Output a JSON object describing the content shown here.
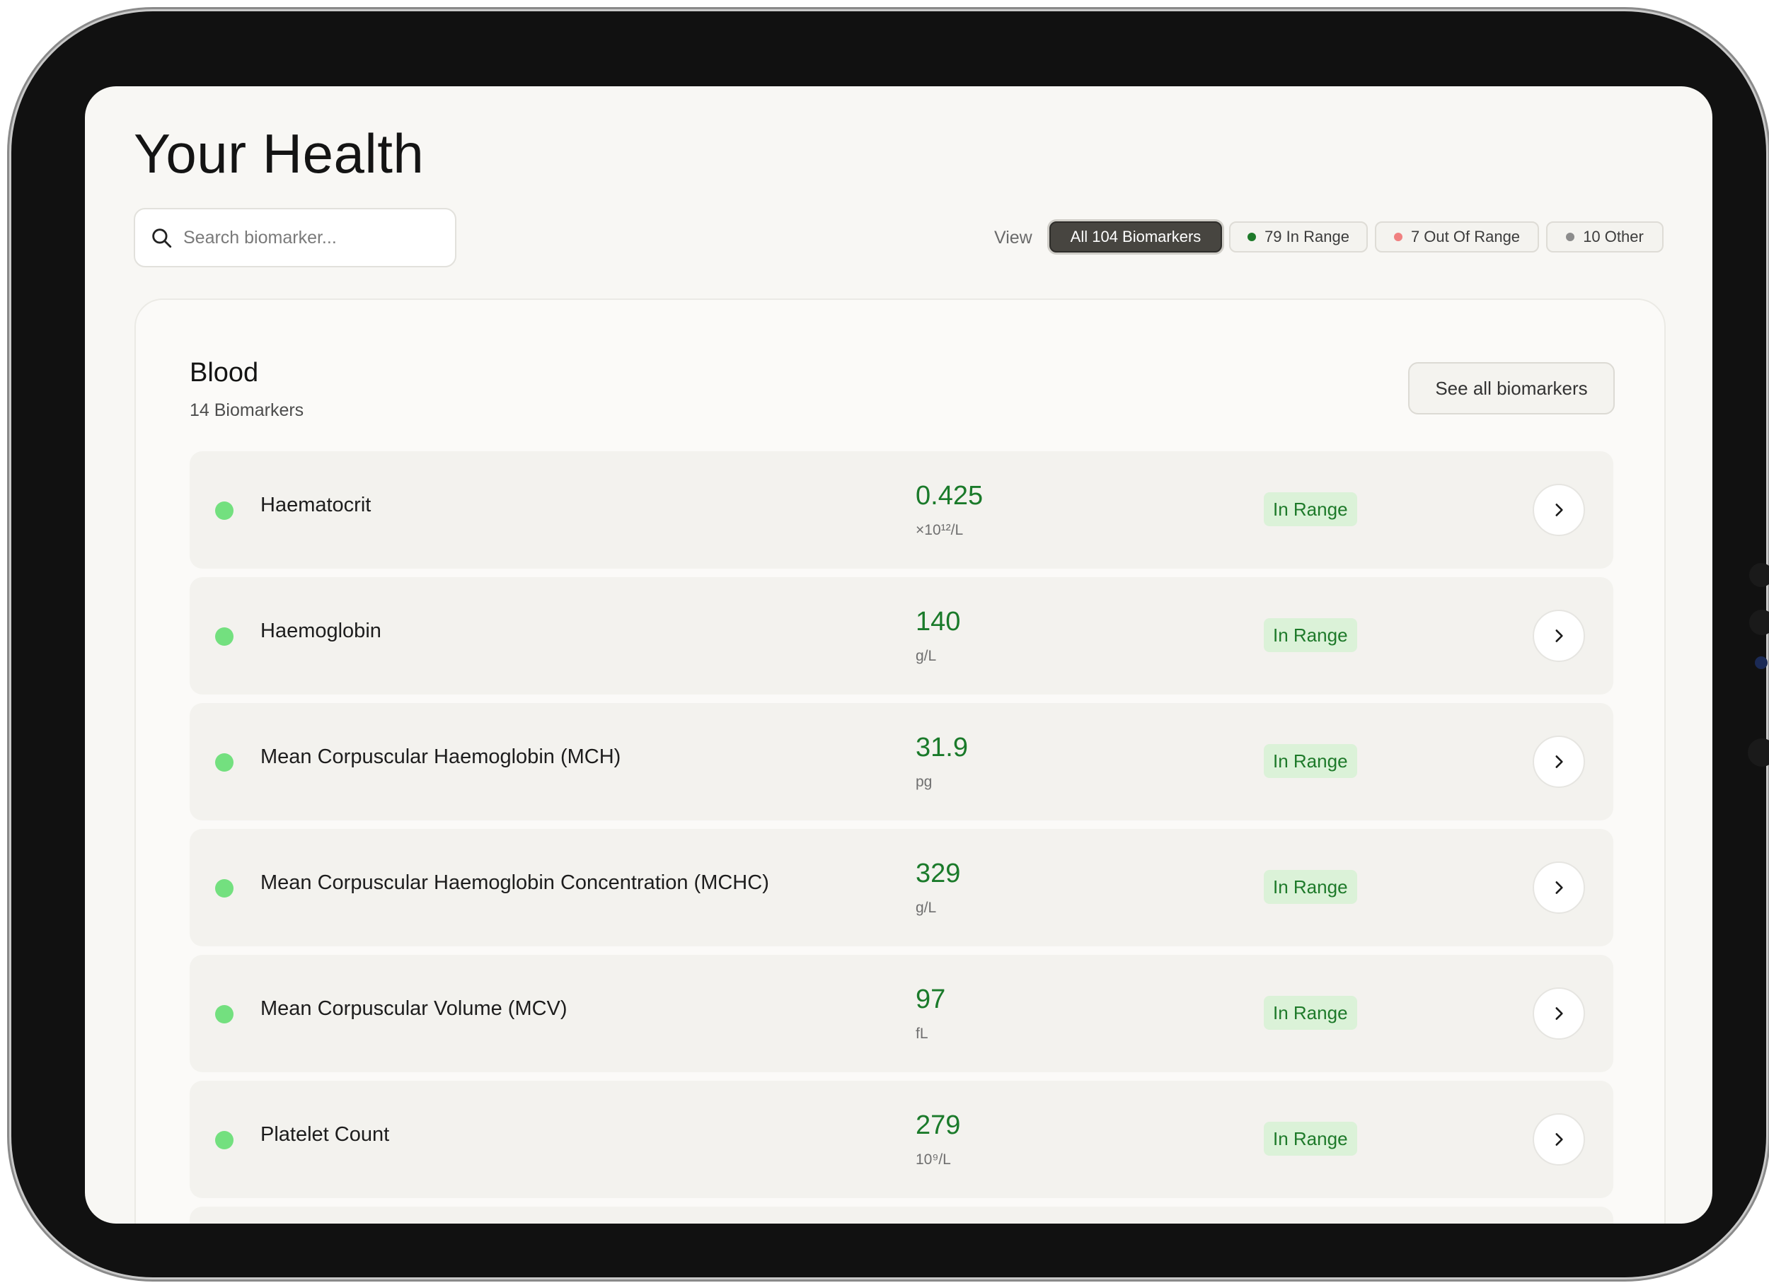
{
  "page": {
    "title": "Your Health"
  },
  "search": {
    "placeholder": "Search biomarker...",
    "icon": "search-icon"
  },
  "view_filter": {
    "label": "View",
    "chips": [
      {
        "label": "All 104 Biomarkers",
        "active": true
      },
      {
        "label": "79 In Range",
        "dot_color": "#1e7a2a"
      },
      {
        "label": "7 Out Of Range",
        "dot_color": "#f08080"
      },
      {
        "label": "10 Other",
        "dot_color": "#8c8c8c"
      }
    ]
  },
  "section": {
    "title": "Blood",
    "count": "14 Biomarkers",
    "see_all_label": "See all biomarkers",
    "rows": [
      {
        "name": "Haematocrit",
        "value": "0.425",
        "unit": "×10¹²/L",
        "status": "In Range"
      },
      {
        "name": "Haemoglobin",
        "value": "140",
        "unit": "g/L",
        "status": "In Range"
      },
      {
        "name": "Mean Corpuscular Haemoglobin (MCH)",
        "value": "31.9",
        "unit": "pg",
        "status": "In Range"
      },
      {
        "name": "Mean Corpuscular Haemoglobin Concentration (MCHC)",
        "value": "329",
        "unit": "g/L",
        "status": "In Range"
      },
      {
        "name": "Mean Corpuscular Volume (MCV)",
        "value": "97",
        "unit": "fL",
        "status": "In Range"
      },
      {
        "name": "Platelet Count",
        "value": "279",
        "unit": "10⁹/L",
        "status": "In Range"
      }
    ]
  },
  "colors": {
    "in_range_dot": "#73e07f",
    "value_text": "#1a7a2a",
    "badge_bg": "#dbf2d8",
    "active_chip_bg": "#474540"
  }
}
